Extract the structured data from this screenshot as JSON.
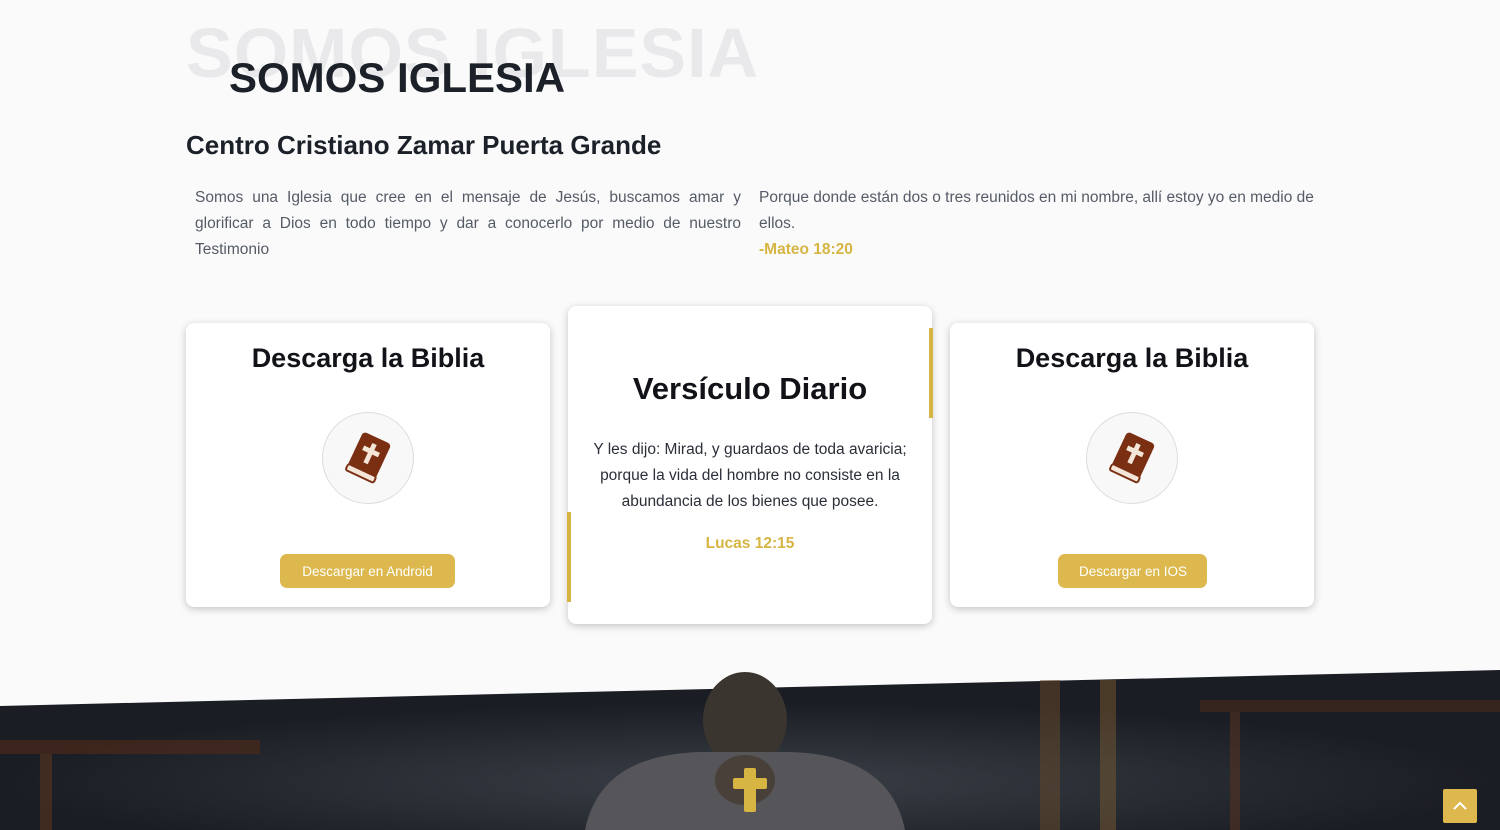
{
  "section": {
    "ghost_title": "SOMOS IGLESIA",
    "title": "SOMOS IGLESIA",
    "subtitle": "Centro Cristiano Zamar Puerta Grande",
    "intro": "Somos una Iglesia que cree en el mensaje de Jesús, buscamos amar y glorificar a Dios en todo tiempo y dar a conocerlo por medio de nuestro Testimonio",
    "verse_text": "Porque donde están dos o tres reunidos en mi nombre, allí estoy yo en medio de ellos.",
    "verse_ref": "-Mateo 18:20"
  },
  "cards": {
    "android": {
      "title": "Descarga la Biblia",
      "icon": "bible-icon",
      "button": "Descargar en Android"
    },
    "daily": {
      "title": "Versículo Diario",
      "text": "Y les dijo: Mirad, y guardaos de toda avaricia; porque la vida del hombre no consiste en la abundancia de los bienes que posee.",
      "ref": "Lucas 12:15"
    },
    "ios": {
      "title": "Descarga la Biblia",
      "icon": "bible-icon",
      "button": "Descargar en IOS"
    }
  },
  "footer_band": {
    "icon": "cross-icon"
  },
  "scroll_top": {
    "icon": "chevron-up-icon"
  },
  "colors": {
    "accent": "#dcb84f",
    "gold_text": "#d6b543",
    "heading": "#1b2029",
    "bible_brown": "#7a2e12",
    "dark_band": "#1d2229"
  }
}
